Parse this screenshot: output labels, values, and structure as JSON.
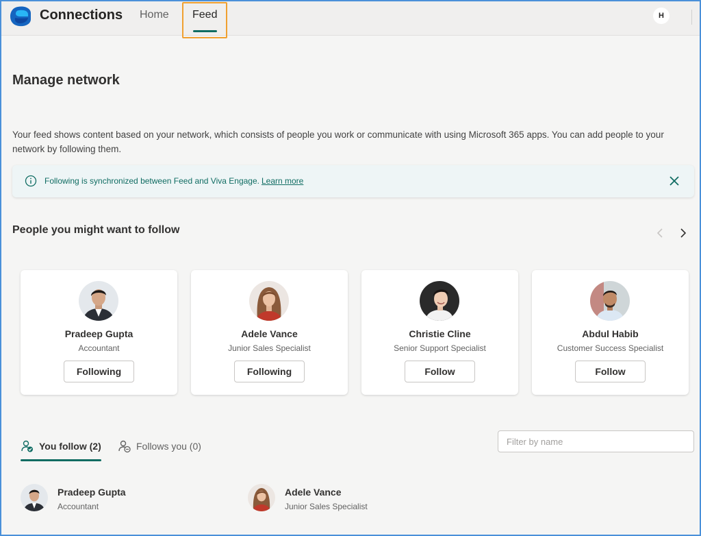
{
  "app": {
    "title": "Connections",
    "avatar_initial": "H"
  },
  "nav": {
    "tabs": [
      {
        "label": "Home"
      },
      {
        "label": "Feed"
      }
    ]
  },
  "page": {
    "title": "Manage network",
    "description": "Your feed shows content based on your network, which consists of people you work or communicate with using Microsoft 365 apps. You can add people to your network by following them."
  },
  "banner": {
    "text": "Following is synchronized between Feed and Viva Engage.",
    "link": "Learn more"
  },
  "suggestions": {
    "title": "People you might want to follow",
    "people": [
      {
        "name": "Pradeep Gupta",
        "role": "Accountant",
        "button": "Following"
      },
      {
        "name": "Adele Vance",
        "role": "Junior Sales Specialist",
        "button": "Following"
      },
      {
        "name": "Christie Cline",
        "role": "Senior Support Specialist",
        "button": "Follow"
      },
      {
        "name": "Abdul Habib",
        "role": "Customer Success Specialist",
        "button": "Follow"
      }
    ]
  },
  "network_tabs": {
    "you_follow": "You follow (2)",
    "follows_you": "Follows you (0)"
  },
  "filter": {
    "placeholder": "Filter by name"
  },
  "following_list": [
    {
      "name": "Pradeep Gupta",
      "role": "Accountant"
    },
    {
      "name": "Adele Vance",
      "role": "Junior Sales Specialist"
    }
  ],
  "colors": {
    "accent": "#0f6c62",
    "highlight": "#f0a030",
    "banner_bg": "#eef5f6"
  }
}
